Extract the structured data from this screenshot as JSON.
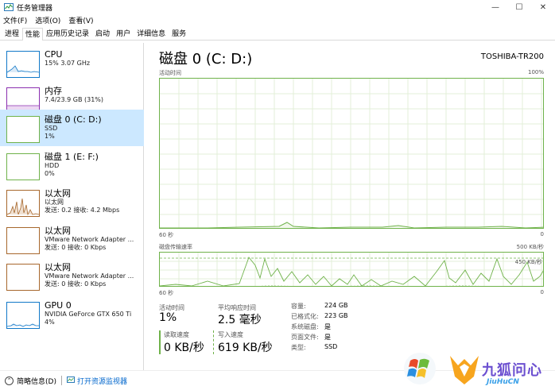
{
  "window": {
    "title": "任务管理器",
    "controls": [
      "—",
      "☐",
      "✕"
    ]
  },
  "menu": [
    "文件(F)",
    "选项(O)",
    "查看(V)"
  ],
  "tabs": [
    "进程",
    "性能",
    "应用历史记录",
    "启动",
    "用户",
    "详细信息",
    "服务"
  ],
  "active_tab": "性能",
  "sidebar": [
    {
      "name": "CPU",
      "sub1": "15% 3.07 GHz",
      "sub2": "",
      "color": "#1178c8"
    },
    {
      "name": "内存",
      "sub1": "7.4/23.9 GB (31%)",
      "sub2": "",
      "color": "#8b2fb0"
    },
    {
      "name": "磁盘 0 (C: D:)",
      "sub1": "SSD",
      "sub2": "1%",
      "color": "#6fb24a",
      "selected": true
    },
    {
      "name": "磁盘 1 (E: F:)",
      "sub1": "HDD",
      "sub2": "0%",
      "color": "#6fb24a"
    },
    {
      "name": "以太网",
      "sub1": "以太网",
      "sub2": "发送: 0.2  接收: 4.2 Mbps",
      "color": "#a7672c"
    },
    {
      "name": "以太网",
      "sub1": "VMware Network Adapter ...",
      "sub2": "发送: 0 接收: 0 Kbps",
      "color": "#a7672c"
    },
    {
      "name": "以太网",
      "sub1": "VMware Network Adapter ...",
      "sub2": "发送: 0 接收: 0 Kbps",
      "color": "#a7672c"
    },
    {
      "name": "GPU 0",
      "sub1": "NVIDIA GeForce GTX 650 Ti",
      "sub2": "4%",
      "color": "#1178c8"
    }
  ],
  "main": {
    "title": "磁盘 0 (C: D:)",
    "model": "TOSHIBA-TR200",
    "chart1": {
      "label": "活动时间",
      "max_label": "100%",
      "time_label": "60 秒",
      "end_label": "0"
    },
    "chart2": {
      "label": "磁盘传输速率",
      "max_label": "500 KB/秒",
      "inner_label": "450 KB/秒",
      "time_label": "60 秒",
      "end_label": "0"
    },
    "stats": {
      "active_time_label": "活动时间",
      "active_time_value": "1%",
      "avg_response_label": "平均响应时间",
      "avg_response_value": "2.5 毫秒",
      "read_speed_label": "读取速度",
      "read_speed_value": "0 KB/秒",
      "write_speed_label": "写入速度",
      "write_speed_value": "619 KB/秒"
    },
    "info": [
      {
        "label": "容量:",
        "value": "224 GB"
      },
      {
        "label": "已格式化:",
        "value": "223 GB"
      },
      {
        "label": "系统磁盘:",
        "value": "是"
      },
      {
        "label": "页面文件:",
        "value": "是"
      },
      {
        "label": "类型:",
        "value": "SSD"
      }
    ]
  },
  "footer": {
    "summary": "简略信息(D)",
    "resmon": "打开资源监视器"
  },
  "watermark": {
    "cn": "九狐问心",
    "en": "JiuHuCN"
  }
}
